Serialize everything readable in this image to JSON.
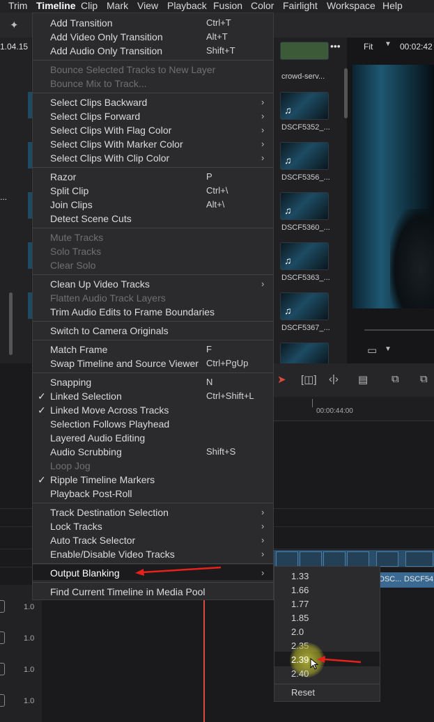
{
  "menubar": {
    "items": [
      "Trim",
      "Timeline",
      "Clip",
      "Mark",
      "View",
      "Playback",
      "Fusion",
      "Color",
      "Fairlight",
      "Workspace",
      "Help"
    ]
  },
  "toolbar": {
    "timecode_left": "1.04.15",
    "zoom": "Fit",
    "timecode_right": "00:02:42",
    "more": "•••"
  },
  "media_pool": {
    "clips": [
      "crowd-serv...",
      "DSCF5352_...",
      "DSCF5356_...",
      "DSCF5360_...",
      "DSCF5363_...",
      "DSCF5367_..."
    ]
  },
  "timeline": {
    "ruler_timecode": "00:00:44:00",
    "clip_labels": [
      "DSC...",
      "DSCF54..."
    ],
    "track_volumes": [
      "1.0",
      "1.0",
      "1.0",
      "1.0"
    ]
  },
  "menu": {
    "items": [
      {
        "label": "Add Transition",
        "shortcut": "Ctrl+T"
      },
      {
        "label": "Add Video Only Transition",
        "shortcut": "Alt+T"
      },
      {
        "label": "Add Audio Only Transition",
        "shortcut": "Shift+T"
      },
      {
        "label": "Bounce Selected Tracks to New Layer",
        "disabled": true
      },
      {
        "label": "Bounce Mix to Track...",
        "disabled": true
      },
      {
        "label": "Select Clips Backward",
        "submenu": true
      },
      {
        "label": "Select Clips Forward",
        "submenu": true
      },
      {
        "label": "Select Clips With Flag Color",
        "submenu": true
      },
      {
        "label": "Select Clips With Marker Color",
        "submenu": true
      },
      {
        "label": "Select Clips With Clip Color",
        "submenu": true
      },
      {
        "label": "Razor",
        "shortcut": "P"
      },
      {
        "label": "Split Clip",
        "shortcut": "Ctrl+\\"
      },
      {
        "label": "Join Clips",
        "shortcut": "Alt+\\"
      },
      {
        "label": "Detect Scene Cuts"
      },
      {
        "label": "Mute Tracks",
        "disabled": true
      },
      {
        "label": "Solo Tracks",
        "disabled": true
      },
      {
        "label": "Clear Solo",
        "disabled": true
      },
      {
        "label": "Clean Up Video Tracks",
        "submenu": true
      },
      {
        "label": "Flatten Audio Track Layers",
        "disabled": true
      },
      {
        "label": "Trim Audio Edits to Frame Boundaries"
      },
      {
        "label": "Switch to Camera Originals"
      },
      {
        "label": "Match Frame",
        "shortcut": "F"
      },
      {
        "label": "Swap Timeline and Source Viewer",
        "shortcut": "Ctrl+PgUp"
      },
      {
        "label": "Snapping",
        "shortcut": "N"
      },
      {
        "label": "Linked Selection",
        "shortcut": "Ctrl+Shift+L",
        "checked": true
      },
      {
        "label": "Linked Move Across Tracks",
        "checked": true
      },
      {
        "label": "Selection Follows Playhead"
      },
      {
        "label": "Layered Audio Editing"
      },
      {
        "label": "Audio Scrubbing",
        "shortcut": "Shift+S"
      },
      {
        "label": "Loop Jog",
        "disabled": true
      },
      {
        "label": "Ripple Timeline Markers",
        "checked": true
      },
      {
        "label": "Playback Post-Roll"
      },
      {
        "label": "Track Destination Selection",
        "submenu": true
      },
      {
        "label": "Lock Tracks",
        "submenu": true
      },
      {
        "label": "Auto Track Selector",
        "submenu": true
      },
      {
        "label": "Enable/Disable Video Tracks",
        "submenu": true
      },
      {
        "label": "Output Blanking",
        "submenu": true,
        "highlighted": true
      },
      {
        "label": "Find Current Timeline in Media Pool"
      }
    ]
  },
  "submenu": {
    "items": [
      "1.33",
      "1.66",
      "1.77",
      "1.85",
      "2.0",
      "2.35",
      "2.39",
      "2.40",
      "Reset"
    ],
    "highlighted": "2.39"
  },
  "colors": {
    "menu_bg": "#2b2b2e",
    "annotation_arrow": "#e8221b",
    "playhead": "#e0483e",
    "clip_blue": "#3a6a92"
  }
}
